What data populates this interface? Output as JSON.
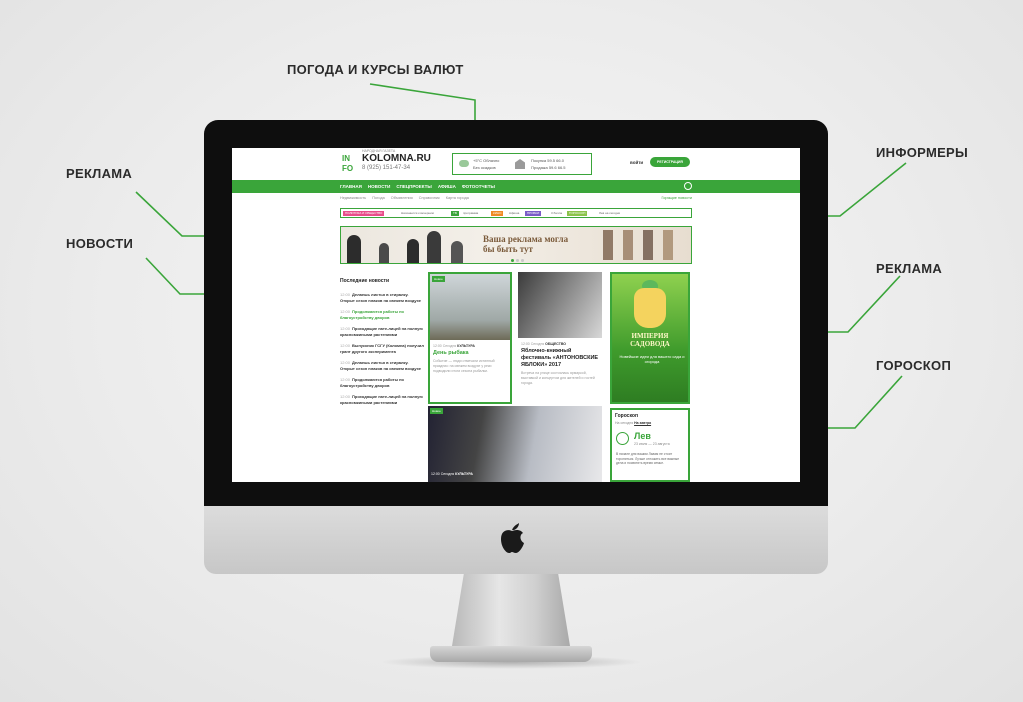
{
  "callouts": {
    "weather": "ПОГОДА И КУРСЫ ВАЛЮТ",
    "ad_top": "РЕКЛАМА",
    "news": "НОВОСТИ",
    "informers": "ИНФОРМЕРЫ",
    "ad_side": "РЕКЛАМА",
    "horoscope": "ГОРОСКОП"
  },
  "colors": {
    "brand_green": "#3aa53a",
    "bezel": "#0e0e0e"
  },
  "site": {
    "logo_top": "IN",
    "logo_bottom": "FO",
    "tagline": "НАРОДНАЯ ГАЗЕТА",
    "name": "KOLOMNA.RU",
    "phone": "8 (925) 151-47-34",
    "weather": {
      "icon": "cloud-icon",
      "temp": "+5°С Облачно",
      "cond": "Без осадков"
    },
    "fx": [
      {
        "label": "Покупка",
        "usd": "59.5",
        "eur": "66.0"
      },
      {
        "label": "Продажа",
        "usd": "59.6",
        "eur": "66.5"
      }
    ],
    "login": "войти",
    "register": "РЕГИСТРАЦИЯ",
    "nav": [
      "ГЛАВНАЯ",
      "НОВОСТИ",
      "СПЕЦПРОЕКТЫ",
      "АФИША",
      "ФОТООТЧЕТЫ"
    ],
    "subnav": [
      "Недвижимость",
      "Погода",
      "Объявления",
      "Справочник",
      "Карта города"
    ],
    "subnav_right": "Горящие новости",
    "informers": [
      {
        "label": "ПОЛИТИКА И ОБЩЕСТВО",
        "color": "#e84d8a"
      },
      {
        "label": "Начинается к вечерним",
        "color": "#ffffff"
      },
      {
        "label": "ТВ",
        "color": "#3aa53a"
      },
      {
        "label": "программа",
        "color": "#ffffff"
      },
      {
        "label": "КИНО",
        "color": "#f08a24"
      },
      {
        "label": "Афиша",
        "color": "#ffffff"
      },
      {
        "label": "ПРОБКИ",
        "color": "#7a5cc7"
      },
      {
        "label": "3 балла",
        "color": "#ffffff"
      },
      {
        "label": "ГОРОСКОП",
        "color": "#8bc34a"
      },
      {
        "label": "Лев на сегодня",
        "color": "#ffffff"
      }
    ],
    "banner_text": "Ваша реклама могла бы быть тут",
    "news_heading": "Последние новости",
    "news_items": [
      {
        "time": "12:00",
        "text": "Делаешь листья в стиралку. Открыт сезон плаков на свежем воздухе",
        "hl": false
      },
      {
        "time": "12:00",
        "text": "Продолжаются работы по благоустройству дворов",
        "hl": true
      },
      {
        "time": "12:00",
        "text": "Проходящие пате-лицей на полную красномкиными растениями",
        "hl": false
      },
      {
        "time": "12:00",
        "text": "Выпускник ГСГУ (Коломна) получил грант другого эксперимента",
        "hl": false
      },
      {
        "time": "12:00",
        "text": "Делаешь листья в стиралку. Открыт сезон плаков на свежем воздухе",
        "hl": false
      },
      {
        "time": "12:00",
        "text": "Продолжаются работы по благоустройству дворов",
        "hl": false
      },
      {
        "time": "12:00",
        "text": "Проходящие пате-лицей на полную красномкиными растениями",
        "hl": false
      }
    ],
    "card1": {
      "tag": "Новое",
      "time": "12:00 Сегодня",
      "section": "КУЛЬТУРА",
      "title": "День рыбака",
      "lead": "Событие — люди отмечали истинный праздник: на свежем воздухе у реки подводили итоги сезона рыбалки."
    },
    "card2": {
      "time": "12:00 Сегодня",
      "section": "ОБЩЕСТВО",
      "title": "Яблочно-книжный фестиваль «АНТОНОВСКИЕ ЯБЛОКИ» 2017",
      "lead": "Встреча на улице состоялась ярмаркой, выставкой и концертом для жителей и гостей города."
    },
    "card3": {
      "tag": "Новое",
      "time": "12:00 Сегодня",
      "section": "КУЛЬТУРА"
    },
    "ad": {
      "title": "ИМПЕРИЯ САДОВОДА",
      "sub": "Новейшие идеи для вашего сада и огорода"
    },
    "horoscope": {
      "title": "Гороскоп",
      "tab1": "На сегодня",
      "tab2": "На завтра",
      "sign": "Лев",
      "dates": "23 июля — 23 августа",
      "text": "В начале дня вашим Львам не стоит торопиться. Лучше отложить все важные дела и посвятить время семье."
    }
  }
}
